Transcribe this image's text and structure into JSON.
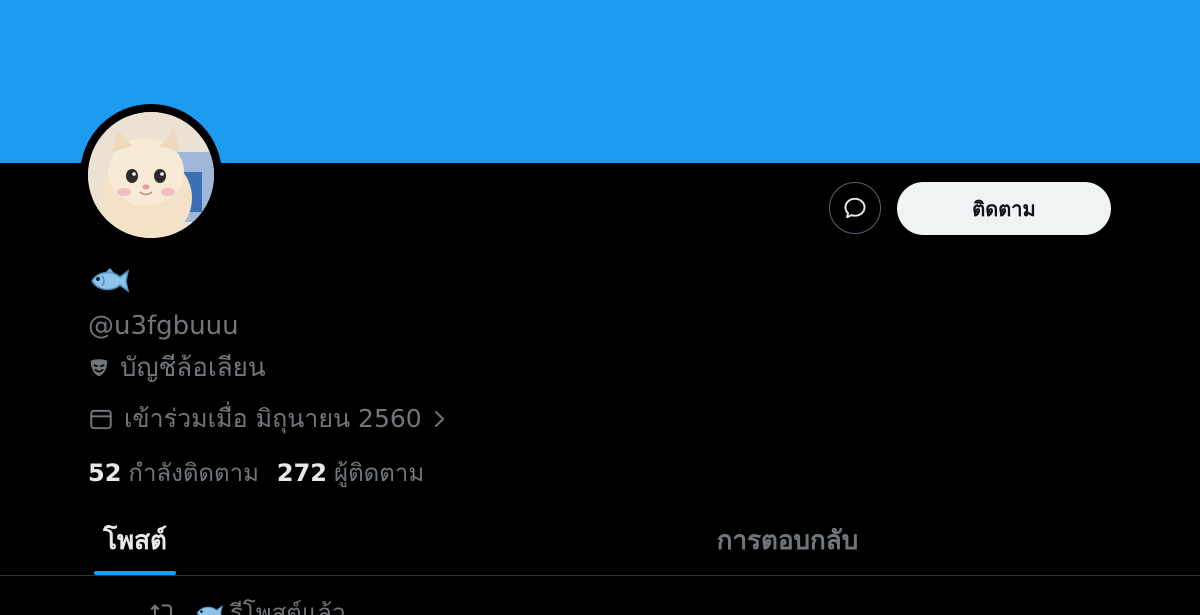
{
  "profile": {
    "display_name_icon": "fish-emoji",
    "handle": "@u3fgbuuu",
    "parody_label": "บัญชีล้อเลียน",
    "parody_icon": "performing-arts-mask-icon",
    "joined_text": "เข้าร่วมเมื่อ มิถุนายน 2560",
    "avatar_icon": "cat-avatar"
  },
  "stats": {
    "following_count": "52",
    "following_label": "กำลังติดตาม",
    "followers_count": "272",
    "followers_label": "ผู้ติดตาม"
  },
  "actions": {
    "message_icon": "message-icon",
    "follow_label": "ติดตาม"
  },
  "tabs": [
    {
      "label": "โพสต์",
      "active": true
    },
    {
      "label": "การตอบกลับ",
      "active": false
    }
  ],
  "feed": {
    "repost_label": "รีโพสต์แล้ว"
  },
  "colors": {
    "banner": "#1d9bf0",
    "accent": "#1d9bf0",
    "background": "#000000",
    "text_primary": "#e7e9ea",
    "text_secondary": "#71767b"
  }
}
